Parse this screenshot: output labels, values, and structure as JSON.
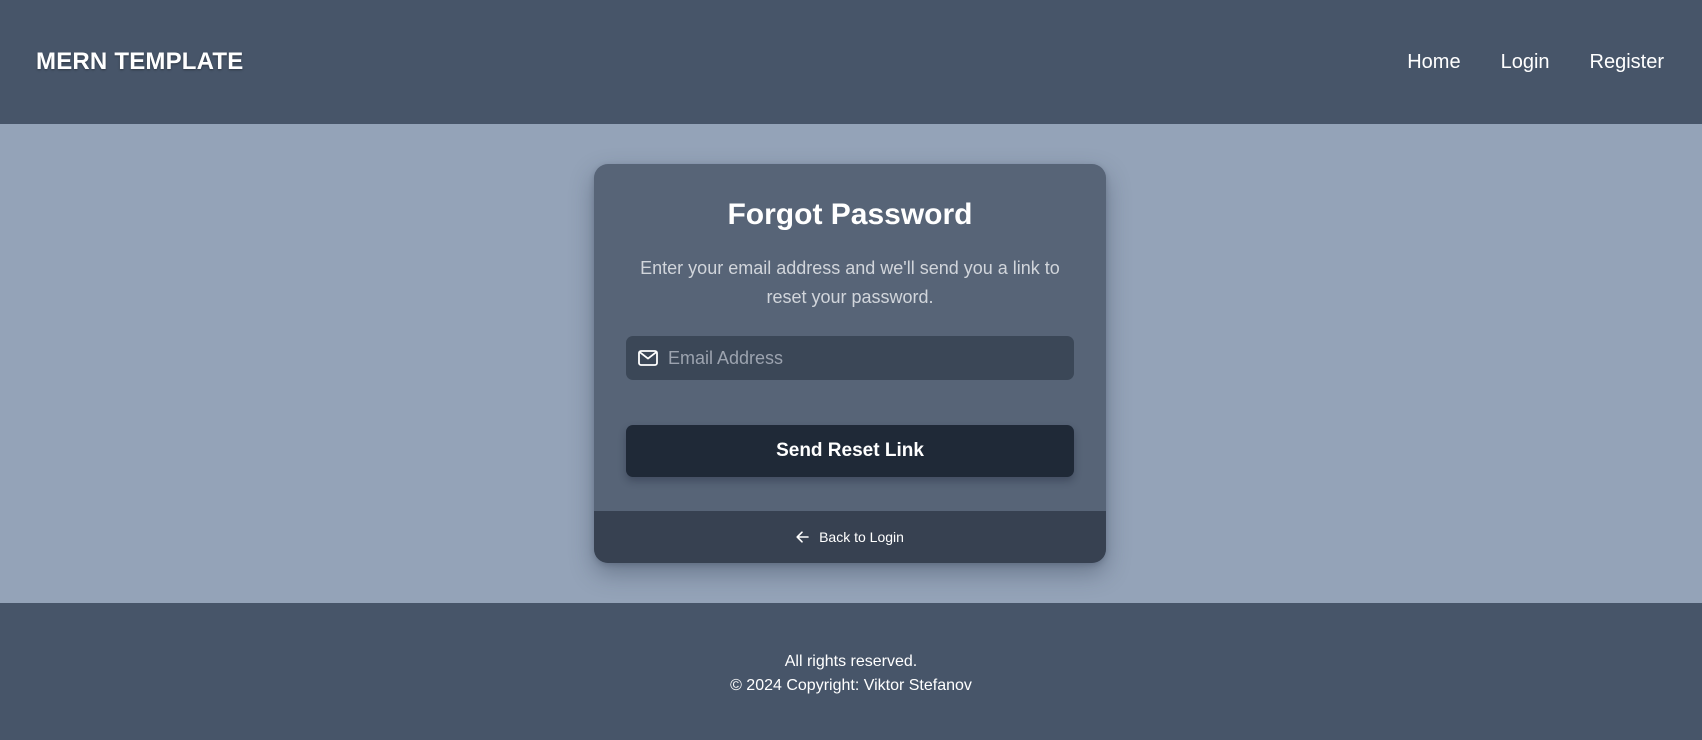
{
  "navbar": {
    "brand": "MERN TEMPLATE",
    "links": [
      {
        "label": "Home"
      },
      {
        "label": "Login"
      },
      {
        "label": "Register"
      }
    ]
  },
  "card": {
    "title": "Forgot Password",
    "description": "Enter your email address and we'll send you a link to reset your password.",
    "email_input": {
      "placeholder": "Email Address",
      "value": "",
      "icon": "mail-icon"
    },
    "submit_label": "Send Reset Link",
    "back_link": {
      "label": "Back to Login",
      "icon": "arrow-left-icon"
    }
  },
  "footer": {
    "line1": "All rights reserved.",
    "line2": "© 2024 Copyright: Viktor Stefanov"
  },
  "colors": {
    "navbar_bg": "#475569",
    "page_bg": "#94a3b8",
    "card_bg": "#576477",
    "input_bg": "#3b4757",
    "button_bg": "#1f2937",
    "card_footer_bg": "#374151"
  }
}
